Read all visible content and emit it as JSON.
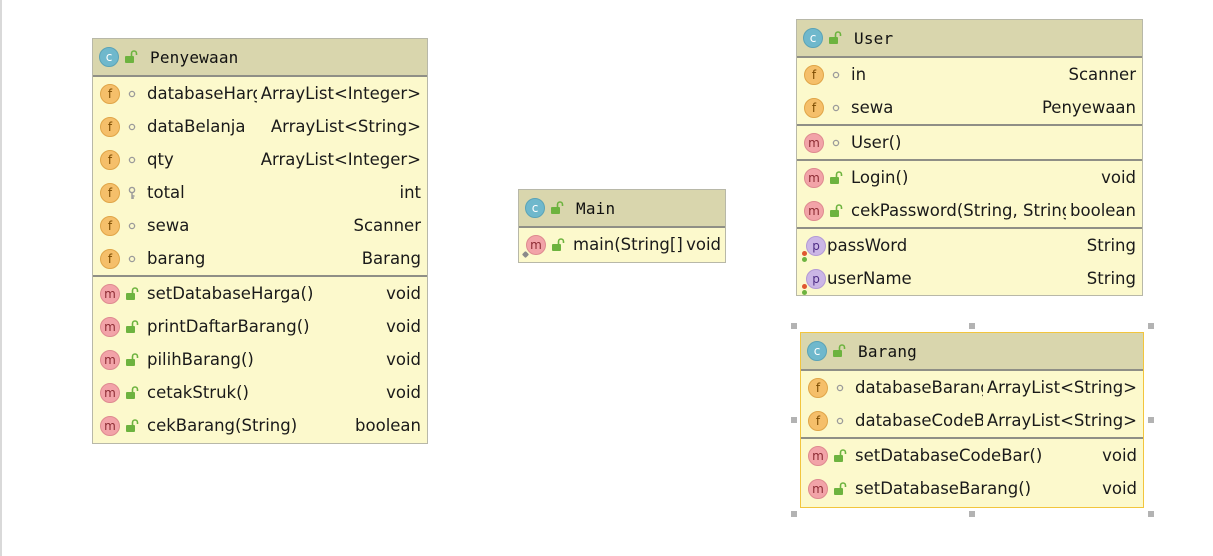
{
  "classes": {
    "penyewaan": {
      "name": "Penyewaan",
      "fields": [
        {
          "name": "databaseHarga",
          "type": "ArrayList<Integer>"
        },
        {
          "name": "dataBelanja",
          "type": "ArrayList<String>"
        },
        {
          "name": "qty",
          "type": "ArrayList<Integer>"
        },
        {
          "name": "total",
          "type": "int"
        },
        {
          "name": "sewa",
          "type": "Scanner"
        },
        {
          "name": "barang",
          "type": "Barang"
        }
      ],
      "methods": [
        {
          "name": "setDatabaseHarga()",
          "type": "void"
        },
        {
          "name": "printDaftarBarang()",
          "type": "void"
        },
        {
          "name": "pilihBarang()",
          "type": "void"
        },
        {
          "name": "cetakStruk()",
          "type": "void"
        },
        {
          "name": "cekBarang(String)",
          "type": "boolean"
        }
      ]
    },
    "main": {
      "name": "Main",
      "methods": [
        {
          "name": "main(String[])",
          "type": "void"
        }
      ]
    },
    "user": {
      "name": "User",
      "fields": [
        {
          "name": "in",
          "type": "Scanner"
        },
        {
          "name": "sewa",
          "type": "Penyewaan"
        }
      ],
      "constructors": [
        {
          "name": "User()",
          "type": ""
        }
      ],
      "methods": [
        {
          "name": "Login()",
          "type": "void"
        },
        {
          "name": "cekPassword(String, String)",
          "type": "boolean"
        }
      ],
      "properties": [
        {
          "name": "passWord",
          "type": "String"
        },
        {
          "name": "userName",
          "type": "String"
        }
      ]
    },
    "barang": {
      "name": "Barang",
      "fields": [
        {
          "name": "databaseBarang",
          "type": "ArrayList<String>"
        },
        {
          "name": "databaseCodeBar",
          "type": "ArrayList<String>"
        }
      ],
      "methods": [
        {
          "name": "setDatabaseCodeBar()",
          "type": "void"
        },
        {
          "name": "setDatabaseBarang()",
          "type": "void"
        }
      ]
    }
  },
  "icons": {
    "class_badge": "c",
    "field_badge": "f",
    "method_badge": "m",
    "property_badge": "p"
  },
  "colors": {
    "body": "#fcf9cc",
    "header": "#d9d6ad",
    "class_badge": "#6fb8cc",
    "field_badge": "#f5bf6a",
    "method_badge": "#f2a3a8",
    "property_badge": "#cbb6e6",
    "public_lock": "#6db33f",
    "selection": "#f2c53d"
  }
}
